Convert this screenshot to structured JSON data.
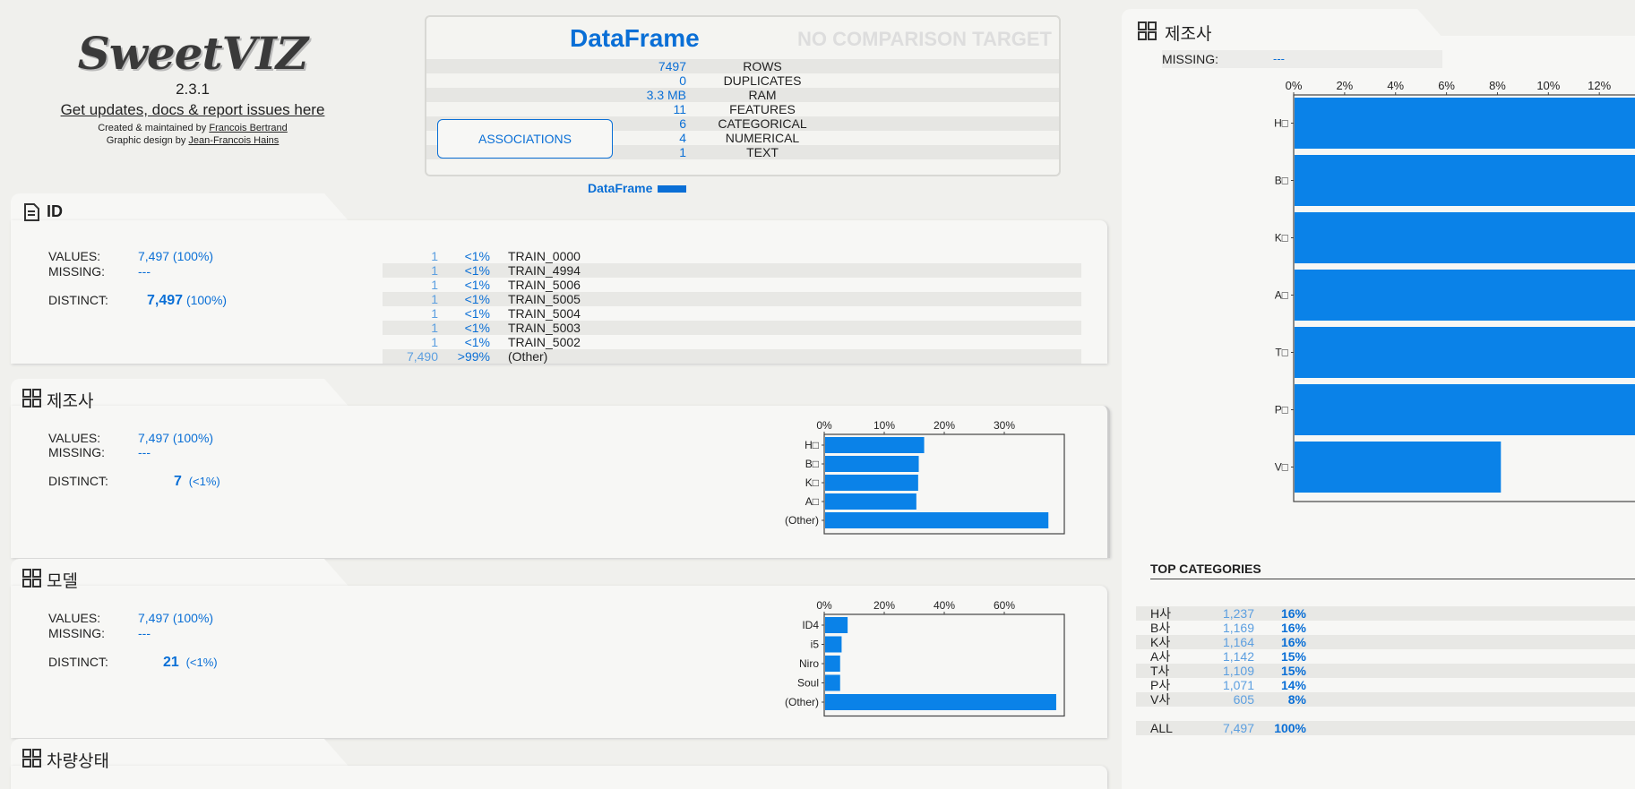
{
  "header": {
    "brand": "SweetVIZ",
    "version": "2.3.1",
    "updates_link": "Get updates, docs & report issues here",
    "created_by_prefix": "Created & maintained by ",
    "created_by_name": "Francois Bertrand",
    "design_prefix": "Graphic design by ",
    "design_name": "Jean-Francois Hains"
  },
  "summary": {
    "source_title": "DataFrame",
    "compare_title": "NO COMPARISON TARGET",
    "rows": [
      {
        "value": "7497",
        "label": "ROWS"
      },
      {
        "value": "0",
        "label": "DUPLICATES"
      },
      {
        "value": "3.3 MB",
        "label": "RAM"
      },
      {
        "value": "11",
        "label": "FEATURES"
      },
      {
        "value": "6",
        "label": "CATEGORICAL"
      },
      {
        "value": "4",
        "label": "NUMERICAL"
      },
      {
        "value": "1",
        "label": "TEXT"
      }
    ],
    "associations_button": "ASSOCIATIONS",
    "legend_label": "DataFrame"
  },
  "colors": {
    "accent": "#0a6fd6",
    "light_accent": "#5c9fe0",
    "bar": "#0a82e8"
  },
  "features": [
    {
      "name": "ID",
      "icon": "text-document-icon",
      "values_label": "VALUES:",
      "values": "7,497 (100%)",
      "missing_label": "MISSING:",
      "missing": "---",
      "distinct_label": "DISTINCT:",
      "distinct": "7,497",
      "distinct_pct": "(100%)",
      "freq": [
        {
          "count": "1",
          "pct": "<1%",
          "name": "TRAIN_0000"
        },
        {
          "count": "1",
          "pct": "<1%",
          "name": "TRAIN_4994"
        },
        {
          "count": "1",
          "pct": "<1%",
          "name": "TRAIN_5006"
        },
        {
          "count": "1",
          "pct": "<1%",
          "name": "TRAIN_5005"
        },
        {
          "count": "1",
          "pct": "<1%",
          "name": "TRAIN_5004"
        },
        {
          "count": "1",
          "pct": "<1%",
          "name": "TRAIN_5003"
        },
        {
          "count": "1",
          "pct": "<1%",
          "name": "TRAIN_5002"
        },
        {
          "count": "7,490",
          "pct": ">99%",
          "name": "(Other)"
        }
      ]
    },
    {
      "name": "제조사",
      "icon": "grid-icon",
      "values_label": "VALUES:",
      "values": "7,497 (100%)",
      "missing_label": "MISSING:",
      "missing": "---",
      "distinct_label": "DISTINCT:",
      "distinct": "7",
      "distinct_pct": "(<1%)"
    },
    {
      "name": "모델",
      "icon": "grid-icon",
      "values_label": "VALUES:",
      "values": "7,497 (100%)",
      "missing_label": "MISSING:",
      "missing": "---",
      "distinct_label": "DISTINCT:",
      "distinct": "21",
      "distinct_pct": "(<1%)"
    },
    {
      "name": "차량상태",
      "icon": "grid-icon"
    }
  ],
  "chart_data": [
    {
      "type": "bar",
      "orientation": "horizontal",
      "categories": [
        "H□",
        "B□",
        "K□",
        "A□",
        "(Other)"
      ],
      "values": [
        16.5,
        15.6,
        15.5,
        15.2,
        37.2
      ],
      "x_ticks": [
        "0%",
        "10%",
        "20%",
        "30%"
      ],
      "xlim": [
        0,
        40
      ]
    },
    {
      "type": "bar",
      "orientation": "horizontal",
      "categories": [
        "ID4",
        "i5",
        "Niro",
        "Soul",
        "(Other)"
      ],
      "values": [
        7.5,
        5.5,
        5,
        5,
        77
      ],
      "x_ticks": [
        "0%",
        "20%",
        "40%",
        "60%"
      ],
      "xlim": [
        0,
        80
      ]
    },
    {
      "type": "bar",
      "orientation": "horizontal",
      "categories": [
        "H□",
        "B□",
        "K□",
        "A□",
        "T□",
        "P□",
        "V□"
      ],
      "values": [
        16.5,
        15.6,
        15.5,
        15.2,
        14.8,
        14.3,
        8.1
      ],
      "x_ticks": [
        "0%",
        "2%",
        "4%",
        "6%",
        "8%",
        "10%",
        "12%"
      ],
      "xlim": [
        0,
        13.4
      ]
    }
  ],
  "detail_panel": {
    "title": "제조사",
    "missing_label": "MISSING:",
    "missing": "---",
    "top_categories_title": "TOP CATEGORIES",
    "top_categories": [
      {
        "name": "H사",
        "count": "1,237",
        "pct": "16%"
      },
      {
        "name": "B사",
        "count": "1,169",
        "pct": "16%"
      },
      {
        "name": "K사",
        "count": "1,164",
        "pct": "16%"
      },
      {
        "name": "A사",
        "count": "1,142",
        "pct": "15%"
      },
      {
        "name": "T사",
        "count": "1,109",
        "pct": "15%"
      },
      {
        "name": "P사",
        "count": "1,071",
        "pct": "14%"
      },
      {
        "name": "V사",
        "count": "605",
        "pct": "8%"
      }
    ],
    "all_row": {
      "name": "ALL",
      "count": "7,497",
      "pct": "100%"
    }
  }
}
